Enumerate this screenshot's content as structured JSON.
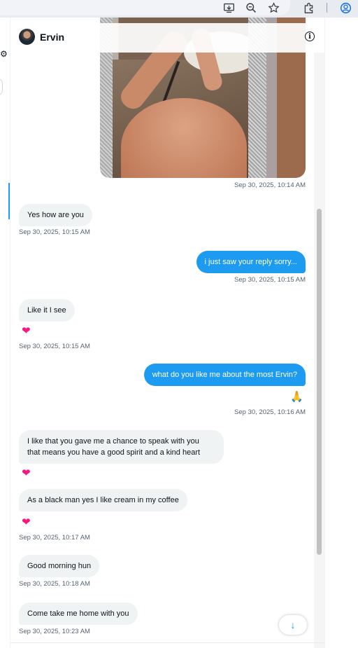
{
  "browser": {
    "icons": [
      "install-icon",
      "zoom-icon",
      "bookmark-star-icon",
      "extensions-icon",
      "profile-icon"
    ]
  },
  "conversation": {
    "contact_name": "Ervin",
    "messages": [
      {
        "side": "out",
        "type": "image",
        "timestamp": "Sep 30, 2025, 10:14 AM"
      },
      {
        "side": "in",
        "text": "Yes how are you",
        "timestamp": "Sep 30, 2025, 10:15 AM"
      },
      {
        "side": "out",
        "text": "i just saw your reply sorry...",
        "timestamp": "Sep 30, 2025, 10:15 AM"
      },
      {
        "side": "in",
        "text": "Like it I see",
        "reaction": "❤",
        "timestamp": "Sep 30, 2025, 10:15 AM"
      },
      {
        "side": "out",
        "text": "what do you like me about the most Ervin?",
        "reaction": "🙏",
        "timestamp": "Sep 30, 2025, 10:16 AM"
      },
      {
        "side": "in",
        "text_lines": [
          "I like that you gave me a chance to speak with you",
          "that means you have a good spirit and a kind heart"
        ],
        "reaction": "❤"
      },
      {
        "side": "in",
        "text": "As a black man yes I like cream in my coffee",
        "reaction": "❤",
        "timestamp": "Sep 30, 2025, 10:17 AM"
      },
      {
        "side": "in",
        "text": "Good morning hun",
        "timestamp": "Sep 30, 2025, 10:18 AM"
      },
      {
        "side": "in",
        "text": "Come take me home with you",
        "timestamp": "Sep 30, 2025, 10:23 AM"
      }
    ]
  },
  "colors": {
    "outgoing_bubble": "#1d9bf0",
    "incoming_bubble": "#eff3f4",
    "heart": "#f91880",
    "timestamp": "#536471"
  }
}
